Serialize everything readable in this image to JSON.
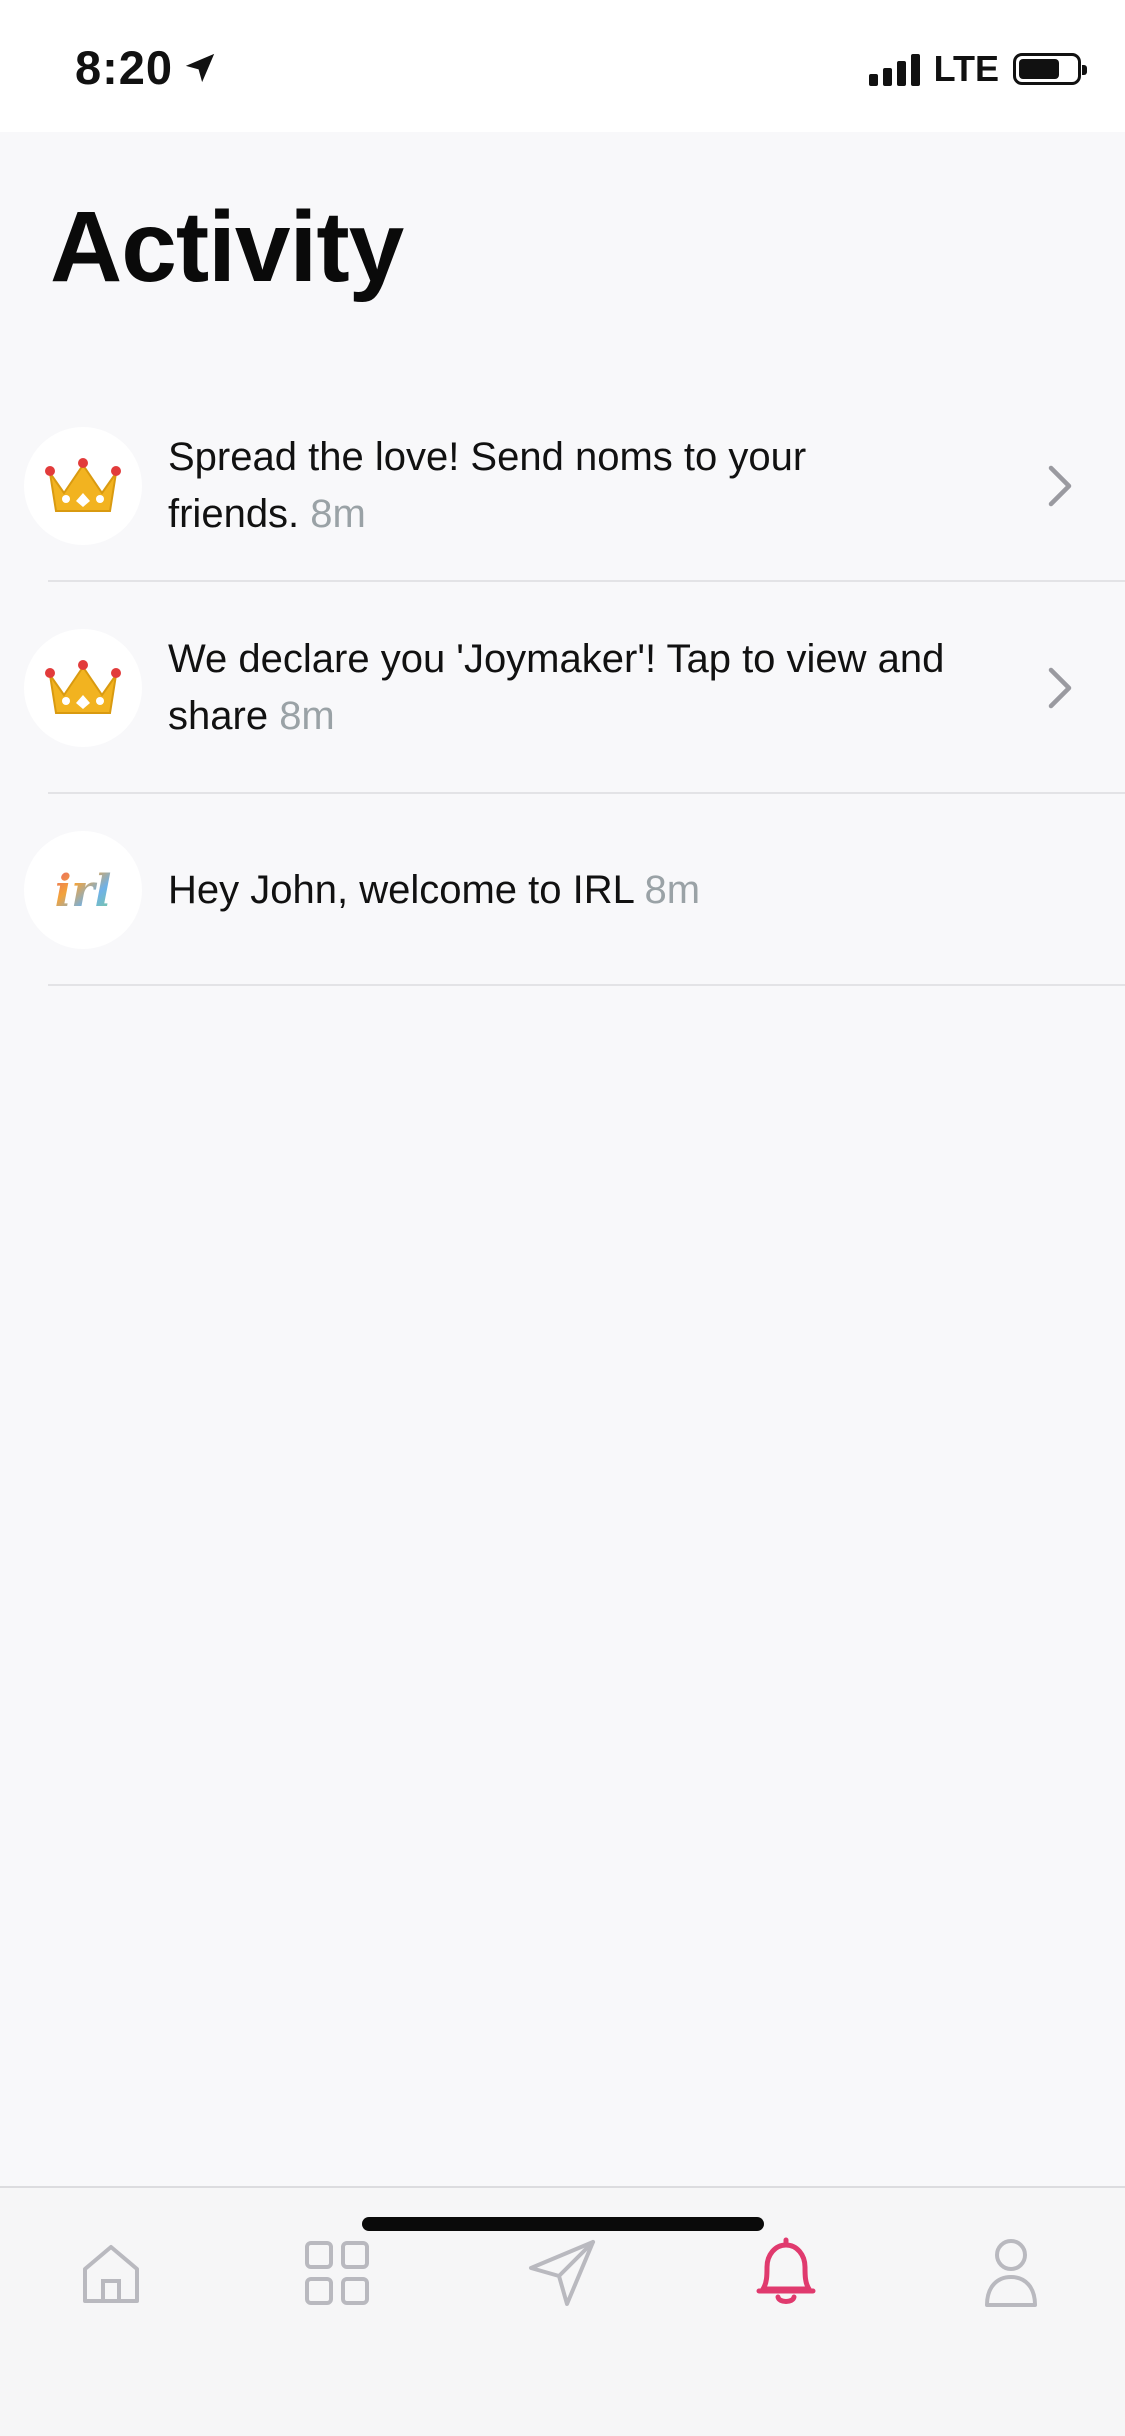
{
  "status_bar": {
    "time": "8:20",
    "network": "LTE"
  },
  "header": {
    "title": "Activity"
  },
  "activity": [
    {
      "text": "Spread the love! Send noms to your friends.",
      "time": "8m",
      "icon": "crown-emoji",
      "has_chevron": true
    },
    {
      "text": "We declare you 'Joymaker'! Tap to view and share",
      "time": "8m",
      "icon": "crown-emoji",
      "has_chevron": true
    },
    {
      "text": "Hey John, welcome to IRL",
      "time": "8m",
      "icon": "irl-logo",
      "logo_text": "irl",
      "has_chevron": false
    }
  ],
  "tab_bar": {
    "tabs": [
      "home-icon",
      "grid-icon",
      "send-icon",
      "bell-icon",
      "profile-icon"
    ],
    "active": "bell-icon",
    "active_color": "#e03a6e",
    "inactive_color": "#b9b9bf"
  }
}
